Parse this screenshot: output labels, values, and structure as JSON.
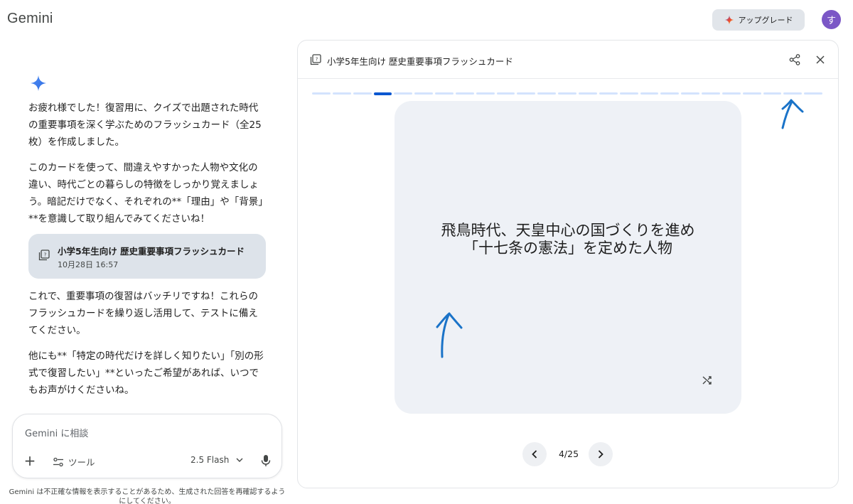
{
  "app": {
    "brand": "Gemini"
  },
  "header": {
    "upgrade_label": "アップグレード",
    "avatar_initial": "す"
  },
  "chat": {
    "para1": [
      "お疲れ様でした！復習用に、クイズで出題された時代",
      "の重要事項を深く学ぶためのフラッシュカード（全25",
      "枚）を作成しました。"
    ],
    "para2": [
      "このカードを使って、間違えやすかった人物や文化の",
      "違い、時代ごとの暮らしの特徴をしっかり覚えましょ",
      "う。暗記だけでなく、それぞれの**「理由」や「背景」",
      "**を意識して取り組んでみてくださいね！"
    ],
    "chip": {
      "title": "小学5年生向け 歴史重要事項フラッシュカード",
      "date": "10月28日 16:57"
    },
    "para3": [
      "これで、重要事項の復習はバッチリですね！これらの",
      "フラッシュカードを繰り返し活用して、テストに備え",
      "てください。"
    ],
    "para4": [
      "他にも**「特定の時代だけを詳しく知りたい」「別の形",
      "式で復習したい」**といったご希望があれば、いつで",
      "もお声がけくださいね。"
    ]
  },
  "input": {
    "placeholder": "Gemini に相談",
    "tools_label": "ツール",
    "model_label": "2.5 Flash"
  },
  "disclaimer": "Gemini は不正確な情報を表示することがあるため、生成された回答を再確認するようにしてください。",
  "panel": {
    "title": "小学5年生向け 歴史重要事項フラッシュカード",
    "card_question_line1": "飛鳥時代、天皇中心の国づくりを進め",
    "card_question_line2": "「十七条の憲法」を定めた人物",
    "counter": "4/25",
    "current_card": 4,
    "total_cards": 25
  },
  "colors": {
    "accent": "#0b57d0",
    "annotation": "#1a73c8",
    "avatar": "#7b57c6"
  }
}
